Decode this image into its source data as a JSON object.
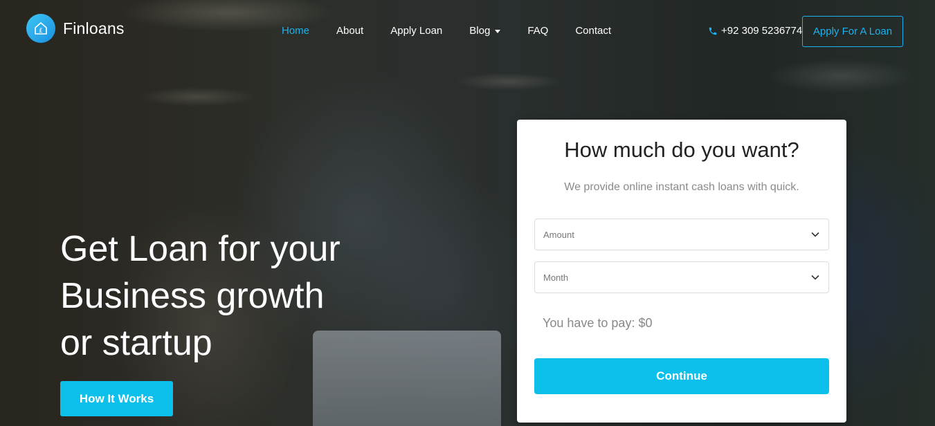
{
  "brand": {
    "name": "Finloans",
    "icon": "house-currency-icon"
  },
  "nav": {
    "items": [
      {
        "label": "Home",
        "active": true
      },
      {
        "label": "About"
      },
      {
        "label": "Apply Loan"
      },
      {
        "label": "Blog",
        "dropdown": true
      },
      {
        "label": "FAQ"
      },
      {
        "label": "Contact"
      }
    ]
  },
  "header": {
    "phone": "+92 309 5236774",
    "phone_icon": "phone-icon",
    "apply_label": "Apply For A Loan"
  },
  "hero": {
    "title_lines": [
      "Get Loan for your",
      "Business growth",
      "or startup"
    ],
    "button_label": "How It Works"
  },
  "calculator": {
    "title": "How much do you want?",
    "subtitle": "We provide online instant cash loans with quick.",
    "amount_placeholder": "Amount",
    "month_placeholder": "Month",
    "pay_text": "You have to pay: $0",
    "continue_label": "Continue"
  },
  "colors": {
    "accent": "#0dc0ec",
    "link_active": "#1ab2f0"
  }
}
